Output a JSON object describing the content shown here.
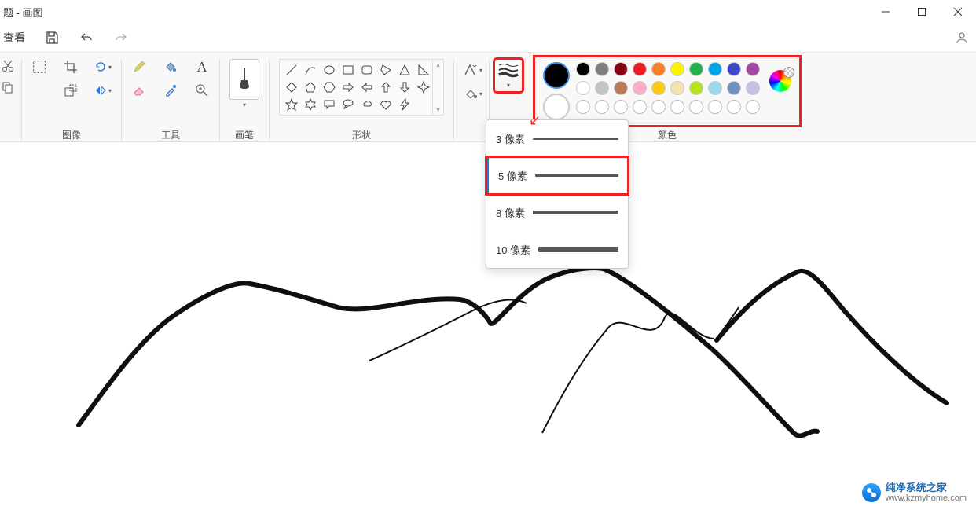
{
  "titlebar": {
    "title": "题 - 画图"
  },
  "toprow": {
    "view": "查看"
  },
  "sections": {
    "image": "图像",
    "tools": "工具",
    "brushes": "画笔",
    "shapes": "形状",
    "colors": "颜色"
  },
  "stroke_menu": {
    "items": [
      {
        "label": "3 像素",
        "height": 2
      },
      {
        "label": "5 像素",
        "height": 3
      },
      {
        "label": "8 像素",
        "height": 5
      },
      {
        "label": "10 像素",
        "height": 7
      }
    ],
    "selected_index": 1
  },
  "palette": {
    "primary": "#000000",
    "secondary": "#ffffff",
    "row1": [
      "#000000",
      "#7f7f7f",
      "#880015",
      "#ed1c24",
      "#ff7f27",
      "#fff200",
      "#22b14c",
      "#00a2e8",
      "#3f48cc",
      "#a349a4"
    ],
    "row2": [
      "#ffffff",
      "#c3c3c3",
      "#b97a57",
      "#ffaec9",
      "#ffc90e",
      "#efe4b0",
      "#b5e61d",
      "#99d9ea",
      "#7092be",
      "#c8bfe7"
    ]
  },
  "watermark": {
    "name": "纯净系统之家",
    "url": "www.kzmyhome.com"
  }
}
